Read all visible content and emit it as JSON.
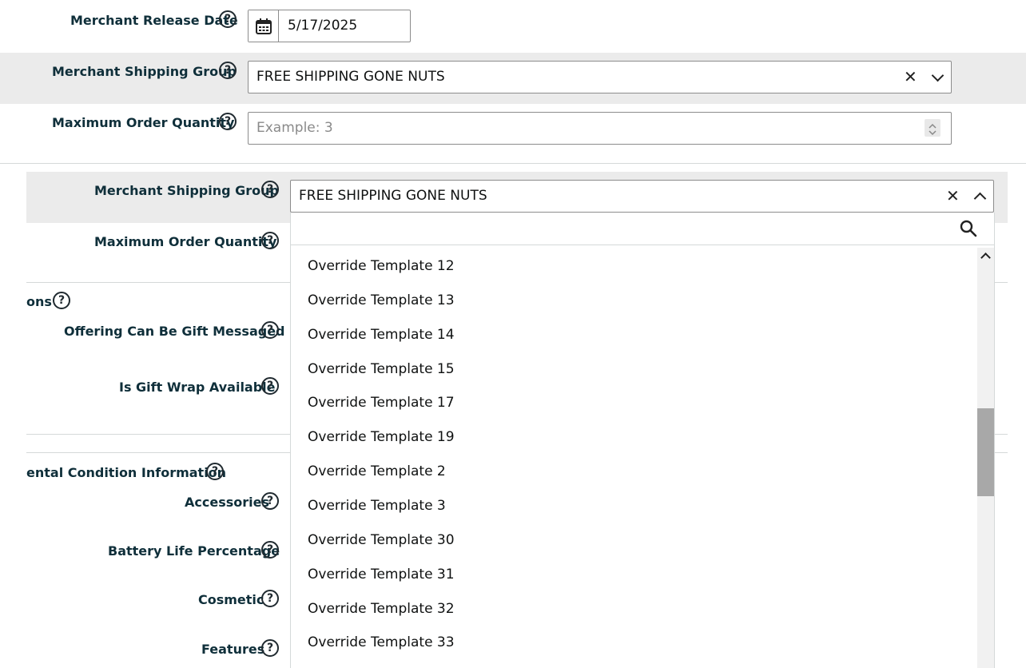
{
  "top_form": {
    "release_date_label": "Merchant Release Date",
    "release_date_value": "5/17/2025",
    "shipping_group_label": "Merchant Shipping Group",
    "shipping_group_value": "FREE SHIPPING GONE NUTS",
    "max_order_label": "Maximum Order Quantity",
    "max_order_placeholder": "Example: 3"
  },
  "lower_form": {
    "shipping_group_label": "Merchant Shipping Group",
    "shipping_group_value": "FREE SHIPPING GONE NUTS",
    "max_order_label": "Maximum Order Quantity",
    "section_gift_title": "ons",
    "gift_message_label": "Offering Can Be Gift Messaged",
    "gift_wrap_label": "Is Gift Wrap Available",
    "section_condition_title": "ental Condition Information",
    "accessories_label": "Accessories",
    "battery_label": "Battery Life Percentage",
    "cosmetic_label": "Cosmetic",
    "features_label": "Features"
  },
  "dropdown": {
    "options": [
      "Override Template 12",
      "Override Template 13",
      "Override Template 14",
      "Override Template 15",
      "Override Template 17",
      "Override Template 19",
      "Override Template 2",
      "Override Template 3",
      "Override Template 30",
      "Override Template 31",
      "Override Template 32",
      "Override Template 33"
    ]
  },
  "icons": {
    "help": "question-circle-icon",
    "calendar": "calendar-icon",
    "clear": "close-icon",
    "chevron": "chevron-icon",
    "search": "search-icon"
  },
  "colors": {
    "label": "#0f2f3a",
    "row_highlight": "#ebebeb",
    "scroll_thumb": "#a8a8a8"
  }
}
